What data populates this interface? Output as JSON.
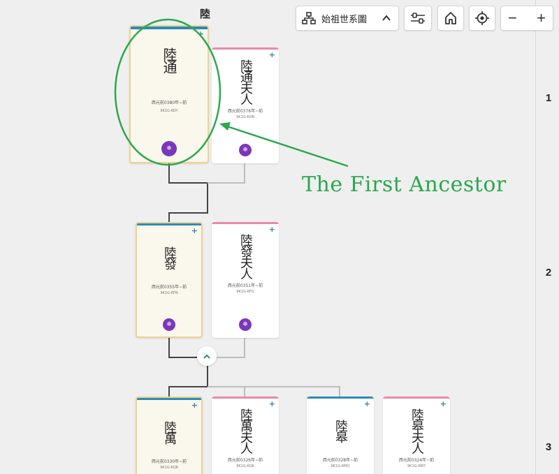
{
  "surname": "陸",
  "toolbar": {
    "chart_select_label": "始祖世系圖",
    "tree_icon": "tree-icon",
    "settings_icon": "sliders-icon",
    "home_icon": "home-icon",
    "locate_icon": "target-icon",
    "zoom_out_label": "−",
    "zoom_in_label": "+"
  },
  "generations": [
    "1",
    "2",
    "3"
  ],
  "cards": {
    "c1": {
      "name": "陸通",
      "dates": "西元前0380年~前",
      "id": "9K1G-6DY"
    },
    "c2": {
      "name": "陸通夫人",
      "dates": "西元前0376年~前",
      "id": "9K1G-6DB"
    },
    "c3": {
      "name": "陸發",
      "dates": "西元前0355年~前",
      "id": "9K1G-6FN"
    },
    "c4": {
      "name": "陸發夫人",
      "dates": "西元前0351年~前",
      "id": "9K1G-6FQ"
    },
    "c5": {
      "name": "陸萬",
      "dates": "西元前0330年~前",
      "id": "9K1G-6Q8"
    },
    "c6": {
      "name": "陸萬夫人",
      "dates": "西元前0326年~前",
      "id": "9K1G-6Q6"
    },
    "c7": {
      "name": "陸皋",
      "dates": "西元前0328年~前",
      "id": "9K1G-6MQ"
    },
    "c8": {
      "name": "陸皋夫人",
      "dates": "西元前0324年~前",
      "id": "9K1G-6M7"
    }
  },
  "annotation": {
    "text": "The First Ancestor",
    "color": "#2aa84e"
  },
  "colors": {
    "male_bar": "#2a8db5",
    "female_bar": "#e88aa8",
    "badge": "#7b37b9",
    "focus_border": "#ecd394"
  }
}
